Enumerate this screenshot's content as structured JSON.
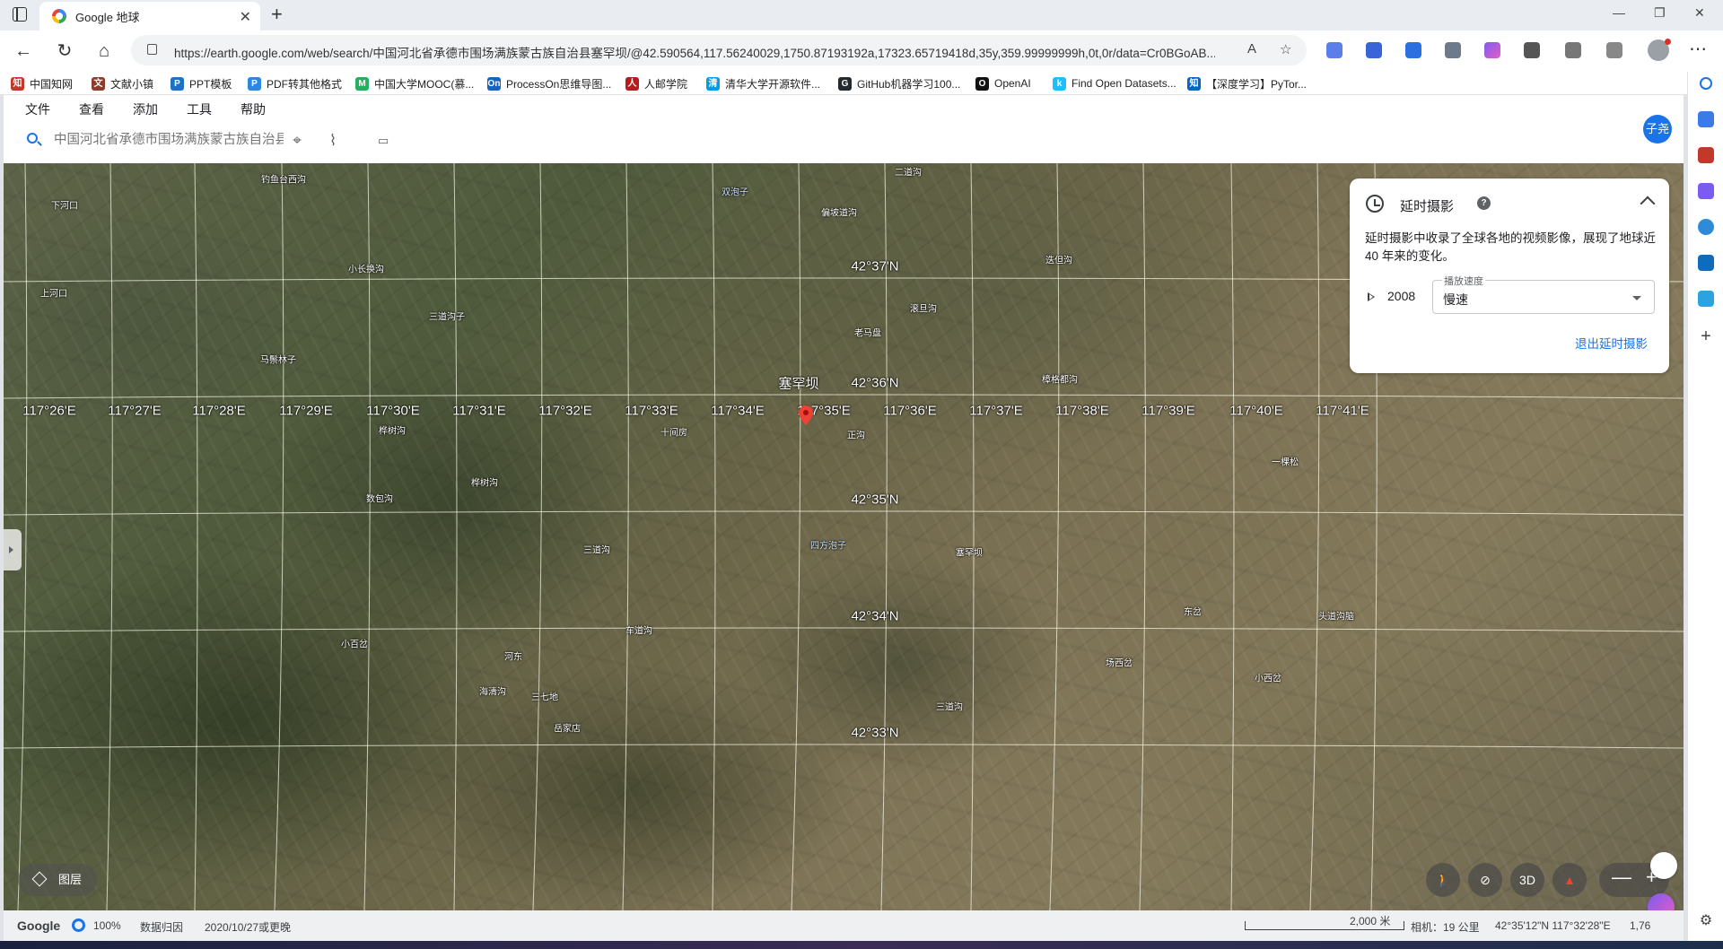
{
  "browser": {
    "tab_title": "Google 地球",
    "url": "https://earth.google.com/web/search/中国河北省承德市围场满族蒙古族自治县塞罕坝/@42.590564,117.56240029,1750.87193192a,17323.65719418d,35y,359.99999999h,0t,0r/data=Cr0BGoAB...",
    "bookmarks": [
      {
        "label": "中国知网",
        "color": "#c0392b"
      },
      {
        "label": "文献小镇",
        "color": "#8e3b2f"
      },
      {
        "label": "PPT模板",
        "color": "#1e73be"
      },
      {
        "label": "PDF转其他格式",
        "color": "#2e86de"
      },
      {
        "label": "中国大学MOOC(慕...",
        "color": "#27ae60"
      },
      {
        "label": "ProcessOn思维导图...",
        "color": "#1565c0"
      },
      {
        "label": "人邮学院",
        "color": "#b71c1c"
      },
      {
        "label": "清华大学开源软件...",
        "color": "#039be5"
      },
      {
        "label": "GitHub机器学习100...",
        "color": "#24292e"
      },
      {
        "label": "OpenAI",
        "color": "#111111"
      },
      {
        "label": "Find Open Datasets...",
        "color": "#20beff"
      },
      {
        "label": "【深度学习】PyTor...",
        "color": "#0066cc"
      }
    ]
  },
  "app": {
    "menu": [
      "文件",
      "查看",
      "添加",
      "工具",
      "帮助"
    ],
    "search_placeholder": "中国河北省承德市围场满族蒙古族自治县塞罕坝",
    "user_initials": "子尧"
  },
  "map": {
    "lat_labels": [
      "42°37'N",
      "42°36'N",
      "42°35'N",
      "42°34'N",
      "42°33'N"
    ],
    "lon_labels": [
      "117°26'E",
      "117°27'E",
      "117°28'E",
      "117°29'E",
      "117°30'E",
      "117°31'E",
      "117°32'E",
      "117°33'E",
      "117°34'E",
      "117°35'E",
      "117°36'E",
      "117°37'E",
      "117°38'E",
      "117°39'E",
      "117°40'E",
      "117°41'E"
    ],
    "selected_place": "塞罕坝",
    "places": [
      "钓鱼台西沟",
      "下河口",
      "双泡子",
      "二道沟",
      "偏坡道沟",
      "小长换沟",
      "迭但沟",
      "上河口",
      "三道沟子",
      "滚旦沟",
      "老马盘",
      "马鬃林子",
      "樟格都沟",
      "桦树沟",
      "十间房",
      "正沟",
      "一棵松",
      "数包沟",
      "桦树沟",
      "三道沟",
      "四方泡子",
      "塞罕坝",
      "东岔",
      "头道沟脑",
      "小百岔",
      "车道沟",
      "河东",
      "场西岔",
      "小西岔",
      "海清沟",
      "三七地",
      "岳家店",
      "三道沟"
    ]
  },
  "timelapse": {
    "title": "延时摄影",
    "help": "?",
    "description": "延时摄影中收录了全球各地的视频影像，展现了地球近 40 年来的变化。",
    "year": "2008",
    "speed_label": "播放速度",
    "speed_value": "慢速",
    "exit_label": "退出延时摄影"
  },
  "controls": {
    "layers_label": "图层",
    "view_3d": "3D",
    "zoom_out": "—",
    "zoom_in": "+"
  },
  "status": {
    "logo": "Google",
    "progress": "100%",
    "data_attribution": "数据归因",
    "imagery_date": "2020/10/27或更晚",
    "scale": "2,000 米",
    "camera": "相机：19 公里",
    "coordinates": "42°35'12\"N 117°32'28\"E",
    "elevation": "1,76"
  }
}
